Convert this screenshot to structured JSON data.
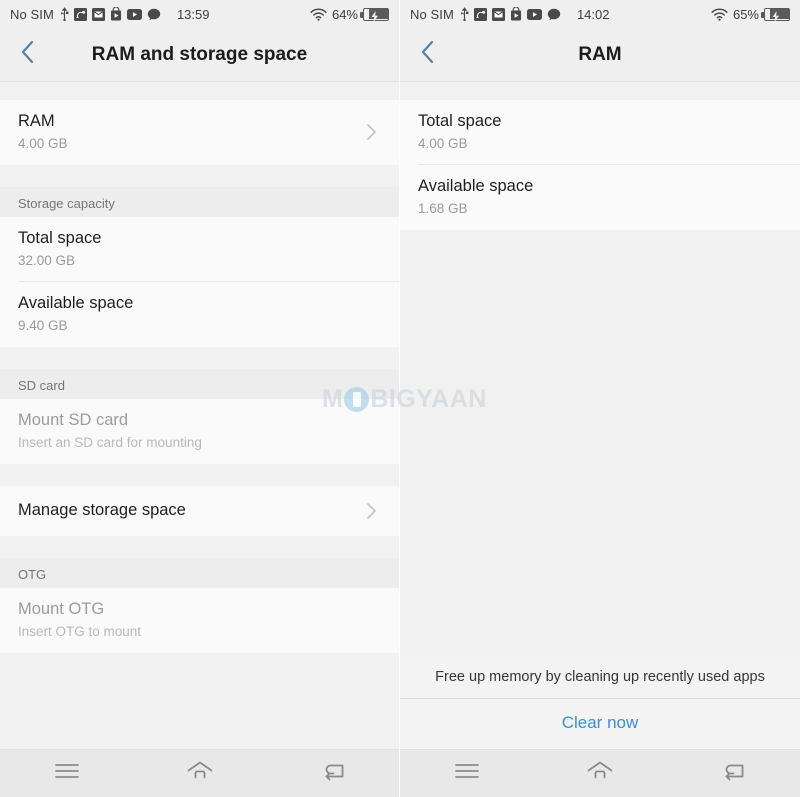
{
  "watermark": {
    "prefix": "M",
    "suffix": "BIGYAAN",
    "icon": "phone-in-circle-icon"
  },
  "left_screen": {
    "status_bar": {
      "carrier": "No SIM",
      "time": "13:59",
      "battery_percent": "64%",
      "icons": [
        "usb-icon",
        "screen-cast-icon",
        "email-icon",
        "play-store-bag-icon",
        "youtube-play-icon",
        "chat-bubble-icon",
        "wifi-icon",
        "battery-charging-icon"
      ]
    },
    "app_bar": {
      "back": "back-chevron",
      "title": "RAM and storage space"
    },
    "rows": [
      {
        "type": "item",
        "title": "RAM",
        "sub": "4.00 GB",
        "chevron": true,
        "disabled": false
      },
      {
        "type": "header",
        "title": "Storage capacity"
      },
      {
        "type": "item",
        "title": "Total space",
        "sub": "32.00 GB",
        "chevron": false,
        "disabled": false,
        "divider": true
      },
      {
        "type": "item",
        "title": "Available space",
        "sub": "9.40 GB",
        "chevron": false,
        "disabled": false
      },
      {
        "type": "header",
        "title": "SD card"
      },
      {
        "type": "item",
        "title": "Mount SD card",
        "sub": "Insert an SD card for mounting",
        "chevron": false,
        "disabled": true
      },
      {
        "type": "item",
        "title": "Manage storage space",
        "sub": "",
        "chevron": true,
        "disabled": false
      },
      {
        "type": "header",
        "title": "OTG"
      },
      {
        "type": "item",
        "title": "Mount OTG",
        "sub": "Insert OTG to mount",
        "chevron": false,
        "disabled": true
      }
    ],
    "nav_bar": {
      "menu": "menu-icon",
      "home": "home-icon",
      "back": "back-icon"
    }
  },
  "right_screen": {
    "status_bar": {
      "carrier": "No SIM",
      "time": "14:02",
      "battery_percent": "65%",
      "icons": [
        "usb-icon",
        "screen-cast-icon",
        "email-icon",
        "play-store-bag-icon",
        "youtube-play-icon",
        "chat-bubble-icon",
        "wifi-icon",
        "battery-charging-icon"
      ]
    },
    "app_bar": {
      "back": "back-chevron",
      "title": "RAM"
    },
    "rows": [
      {
        "type": "item",
        "title": "Total space",
        "sub": "4.00 GB",
        "divider": true
      },
      {
        "type": "item",
        "title": "Available space",
        "sub": "1.68 GB"
      }
    ],
    "footer_note": "Free up memory by cleaning up recently used apps",
    "clear_button": "Clear now",
    "nav_bar": {
      "menu": "menu-icon",
      "home": "home-icon",
      "back": "back-icon"
    }
  },
  "colors": {
    "accent_blue": "#3d8fd1",
    "back_chevron": "#4f81a8",
    "row_bg": "#fafafa",
    "page_bg": "#f1f1f1",
    "bar_bg": "#efefef",
    "nav_bg": "#e8e8e8",
    "title_text": "#1f1f1f",
    "sub_text": "#9a9a9a",
    "disabled_text": "#9c9c9c"
  }
}
